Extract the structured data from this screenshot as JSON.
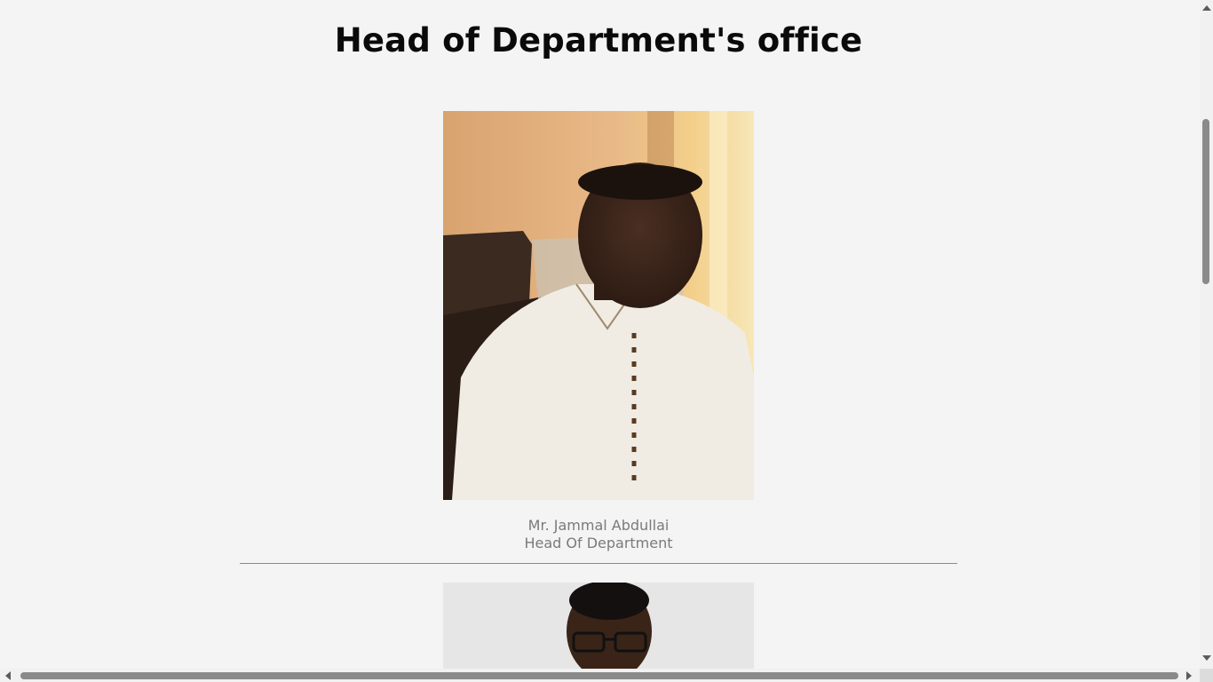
{
  "page": {
    "title": "Head of Department's office"
  },
  "staff": [
    {
      "name": "Mr. Jammal Abdullai",
      "role": "Head Of Department"
    }
  ],
  "colors": {
    "background": "#f4f4f4",
    "title": "#0a0a0a",
    "caption": "#7a7a7a",
    "divider": "#8a8a8a"
  },
  "icons": {
    "scroll_up": "triangle-up",
    "scroll_down": "triangle-down",
    "scroll_left": "triangle-left",
    "scroll_right": "triangle-right"
  }
}
